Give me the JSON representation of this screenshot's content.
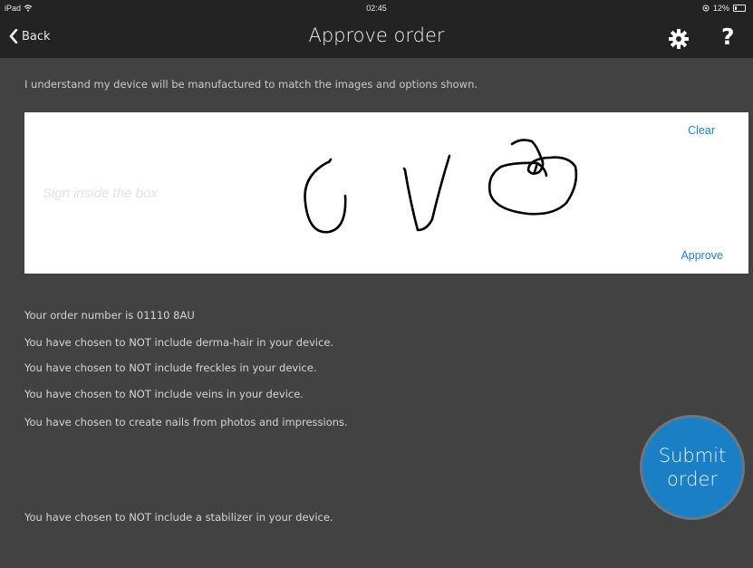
{
  "status_bar": {
    "device": "iPad",
    "time": "02:45",
    "battery": "12%"
  },
  "nav": {
    "back_label": "Back",
    "title": "Approve order",
    "help_label": "?"
  },
  "intro_text": "I understand my device will be manufactured to match the images and options shown.",
  "signature": {
    "hint": "Sign inside the box",
    "clear_label": "Clear",
    "approve_label": "Approve"
  },
  "order": {
    "number_line": "Your order number is 01110 8AU",
    "lines": [
      "You have chosen to NOT include derma-hair in your device.",
      "You have chosen to NOT include freckles in your device.",
      "You have chosen to NOT include veins in your device.",
      "You have chosen to create nails from photos and impressions.",
      "You have chosen to NOT include a stabilizer in your device."
    ]
  },
  "submit": {
    "line1": "Submit",
    "line2": "order"
  },
  "icons": {
    "back": "chevron-left-icon",
    "settings": "gear-icon",
    "wifi": "wifi-icon",
    "battery": "battery-icon"
  },
  "colors": {
    "background": "#424242",
    "topbar": "#232323",
    "accent": "#1b7fc6",
    "link": "#1e7fd2"
  }
}
